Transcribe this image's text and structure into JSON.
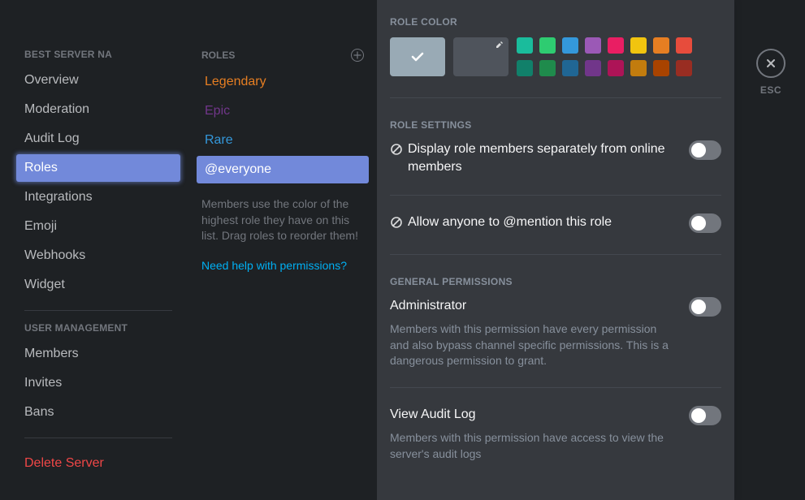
{
  "sidebar": {
    "section1_header": "Best Server NA",
    "items": [
      "Overview",
      "Moderation",
      "Audit Log",
      "Roles",
      "Integrations",
      "Emoji",
      "Webhooks",
      "Widget"
    ],
    "selected_index": 3,
    "section2_header": "User Management",
    "user_items": [
      "Members",
      "Invites",
      "Bans"
    ],
    "delete_label": "Delete Server"
  },
  "roles_col": {
    "header": "Roles",
    "items": [
      {
        "label": "Legendary",
        "color": "#e67e22"
      },
      {
        "label": "Epic",
        "color": "#71368a"
      },
      {
        "label": "Rare",
        "color": "#3498db"
      },
      {
        "label": "@everyone",
        "color": "#ffffff"
      }
    ],
    "selected_index": 3,
    "tip": "Members use the color of the highest role they have on this list. Drag roles to reorder them!",
    "help_link": "Need help with permissions?"
  },
  "main": {
    "role_color_header": "Role Color",
    "default_color": "#99aab5",
    "custom_color_bg": "#4f545c",
    "palette": [
      "#1abc9c",
      "#2ecc71",
      "#3498db",
      "#9b59b6",
      "#e91e63",
      "#f1c40f",
      "#e67e22",
      "#e74c3c",
      "#11806a",
      "#1f8b4c",
      "#206694",
      "#71368a",
      "#ad1457",
      "#c27c0e",
      "#a84300",
      "#992d22"
    ],
    "role_settings_header": "Role Settings",
    "setting_display_separately": "Display role members separately from online members",
    "setting_allow_mention": "Allow anyone to @mention this role",
    "general_permissions_header": "General Permissions",
    "perm_admin_title": "Administrator",
    "perm_admin_desc": "Members with this permission have every permission and also bypass channel specific permissions. This is a dangerous permission to grant.",
    "perm_auditlog_title": "View Audit Log",
    "perm_auditlog_desc": "Members with this permission have access to view the server's audit logs"
  },
  "close": {
    "esc_label": "ESC"
  }
}
